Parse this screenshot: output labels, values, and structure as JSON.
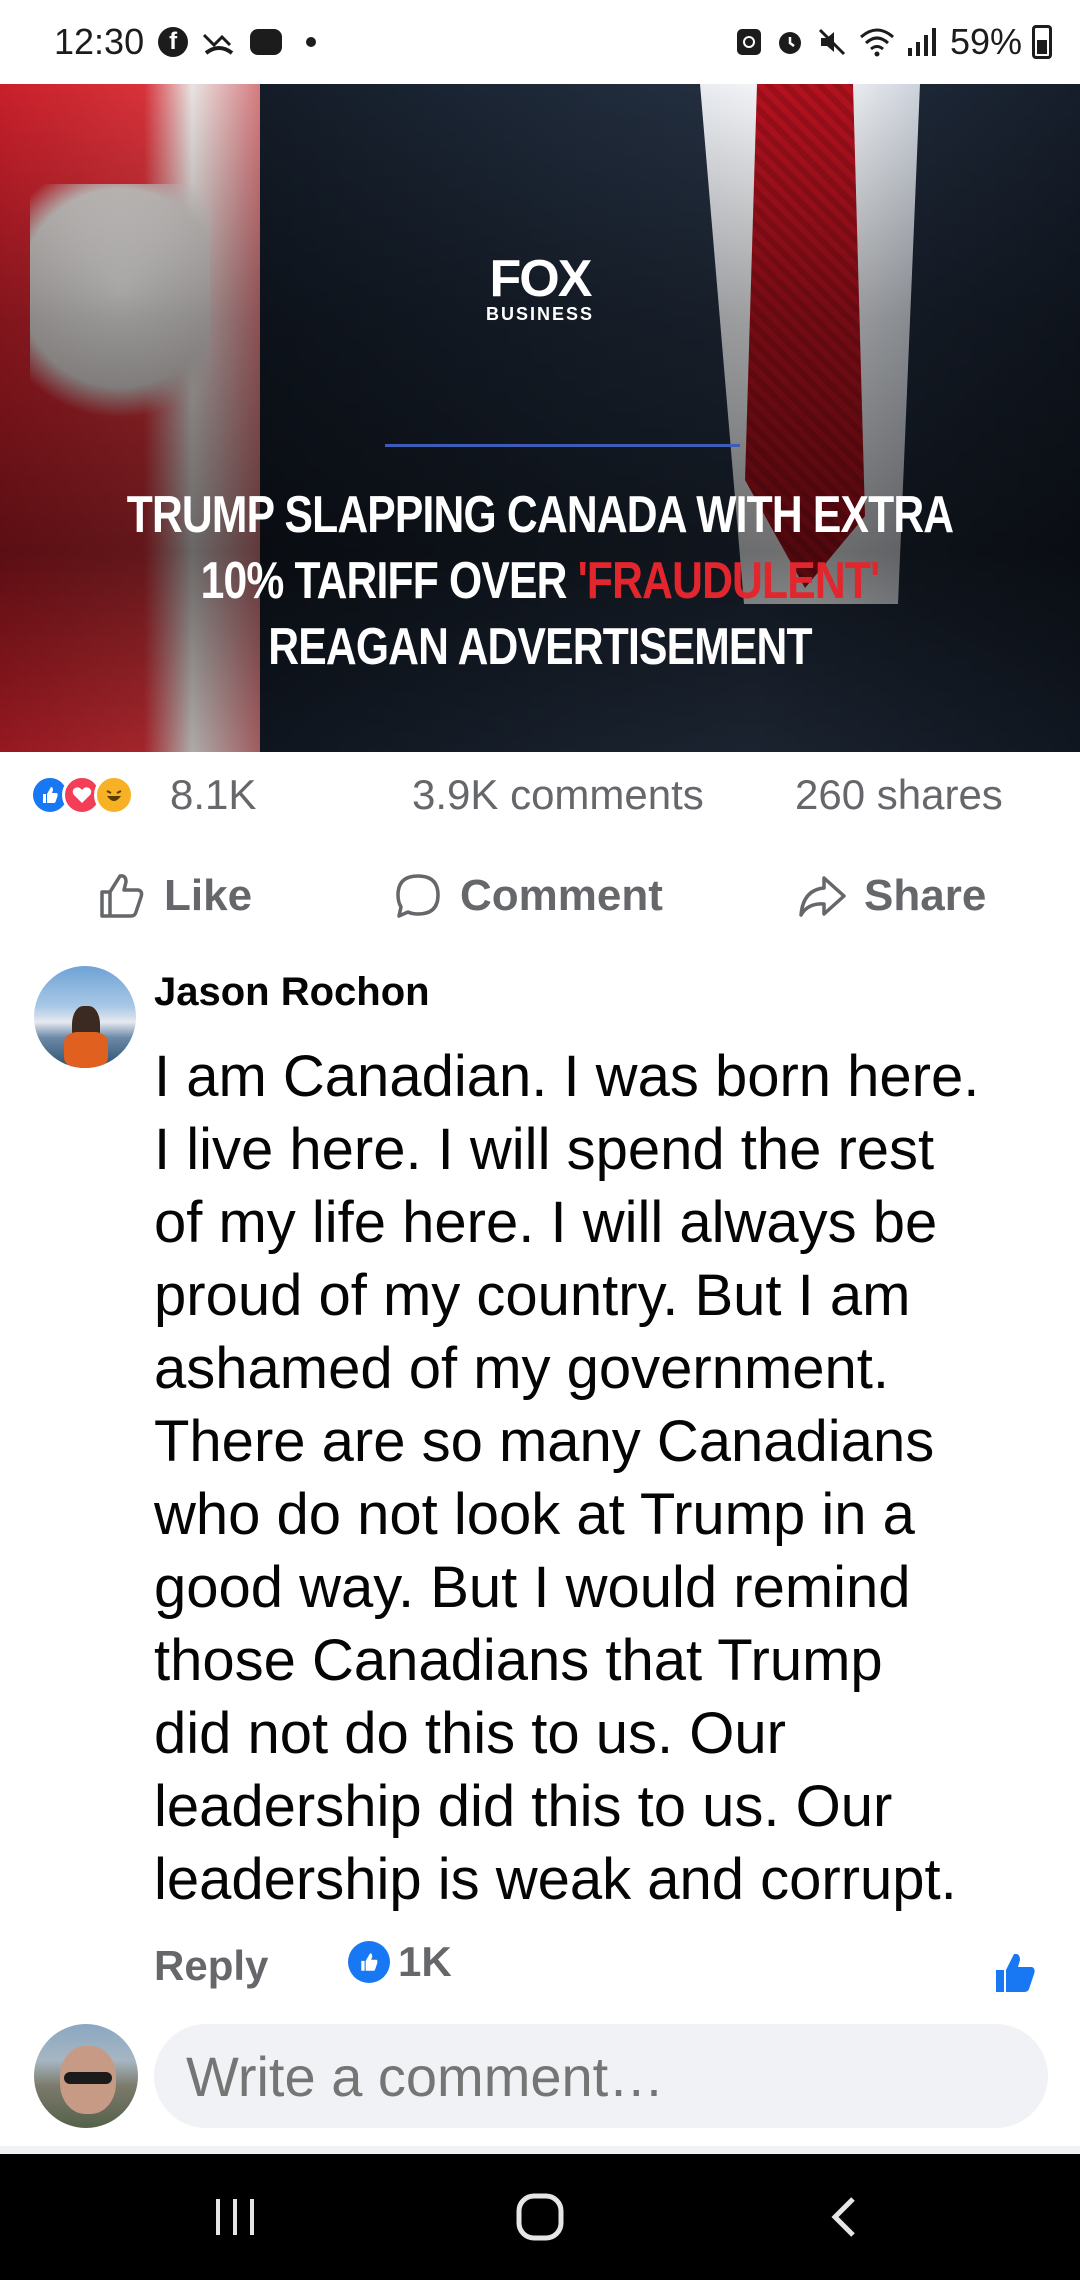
{
  "status_bar": {
    "time": "12:30",
    "battery": "59%",
    "icons": [
      "facebook-icon",
      "missed-call-icon",
      "message-icon",
      "notification-dot-icon",
      "recycle-icon",
      "alarm-icon",
      "mute-icon",
      "wifi-icon",
      "signal-icon",
      "battery-icon"
    ]
  },
  "post_image": {
    "brand": "FOX",
    "brand_sub": "BUSINESS",
    "headline_line1": "TRUMP SLAPPING CANADA WITH EXTRA",
    "headline_line2_a": "10% TARIFF OVER ",
    "headline_line2_b": "'FRAUDULENT'",
    "headline_line3": "REAGAN ADVERTISEMENT",
    "accent_red": "#e2262e"
  },
  "engagement": {
    "reactions": [
      "like",
      "love",
      "haha"
    ],
    "reaction_count": "8.1K",
    "comments": "3.9K comments",
    "shares": "260 shares"
  },
  "actions": {
    "like": "Like",
    "comment": "Comment",
    "share": "Share"
  },
  "comment": {
    "author": "Jason Rochon",
    "lines": [
      "I am Canadian. I was born here.",
      "I live here. I will spend the rest",
      "of my life here. I will always be",
      "proud of my country. But I am",
      "ashamed of my government.",
      "There are so many Canadians",
      "who do not look at Trump in a",
      "good way. But I would remind",
      "those Canadians that Trump",
      "did not do this to us. Our",
      "leadership did this to us. Our",
      "leadership is weak and corrupt."
    ],
    "reply_label": "Reply",
    "like_count": "1K"
  },
  "composer": {
    "placeholder": "Write a comment…"
  },
  "colors": {
    "facebook_blue": "#1877f2",
    "muted_text": "#65676b",
    "input_bg": "#f0f2f5"
  }
}
